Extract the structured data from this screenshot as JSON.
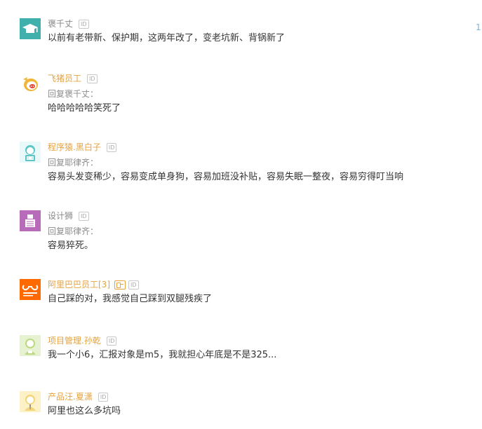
{
  "page_number": "1",
  "id_badge_label": "ID",
  "reply_prefix": "回复",
  "colors": {
    "username_gray": "#888888",
    "username_orange": "#e6a23c",
    "content_text": "#333333",
    "reply_text": "#8c8c8c",
    "page_number": "#7fb2d8"
  },
  "comments": [
    {
      "avatar_icon": "graduation-cap-icon",
      "avatar_color": "#3fb0ac",
      "username": "褒千丈",
      "content": "以前有老带新、保护期，这两年改了，变老坑新、背锅新了"
    },
    {
      "avatar_icon": "pig-logo-icon",
      "avatar_color": "#f0b63a",
      "username": "飞猪员工",
      "reply_target": "褒千丈：",
      "content": "哈哈哈哈哈笑死了"
    },
    {
      "avatar_icon": "programmer-icon",
      "avatar_color": "#5cc6c9",
      "username": "程序猿.黑白子",
      "reply_target": "耶律齐：",
      "content": "容易头发变稀少，容易变成单身狗，容易加班没补贴，容易失眠一整夜，容易穷得叮当响"
    },
    {
      "avatar_icon": "designer-icon",
      "avatar_color": "#b86bb8",
      "username": "设计狮",
      "reply_target": "耶律齐：",
      "content": "容易猝死。"
    },
    {
      "avatar_icon": "alibaba-logo-icon",
      "avatar_color": "#ff6a00",
      "username": "阿里巴巴员工[3]",
      "content": "自己踩的对，我感觉自己踩到双腿残疾了"
    },
    {
      "avatar_icon": "project-manager-icon",
      "avatar_color": "#bcd97f",
      "username": "项目管理.孙乾",
      "content": "我一个小6，汇报对象是m5，我就担心年底是不是325..."
    },
    {
      "avatar_icon": "product-manager-icon",
      "avatar_color": "#f3d57a",
      "username": "产品汪.夏潇",
      "content": "阿里也这么多坑吗"
    }
  ]
}
